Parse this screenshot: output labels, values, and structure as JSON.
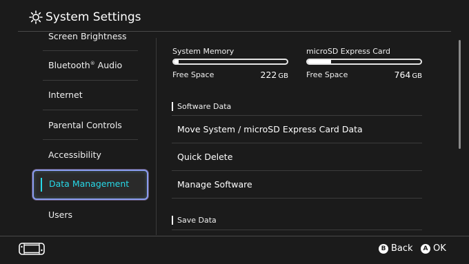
{
  "header": {
    "title": "System Settings",
    "icon": "gear-icon"
  },
  "sidebar": {
    "items": [
      {
        "label": "Screen Brightness"
      },
      {
        "label": "Bluetooth",
        "superscript": "®",
        "suffix": " Audio"
      },
      {
        "label": "Internet"
      },
      {
        "label": "Parental Controls"
      },
      {
        "label": "Accessibility"
      },
      {
        "label": "Data Management",
        "selected": true
      },
      {
        "label": "Users"
      }
    ]
  },
  "storage": {
    "system": {
      "label": "System Memory",
      "free_label": "Free Space",
      "free_value": "222",
      "free_unit": "GB",
      "used_fraction": 0.04
    },
    "sd": {
      "label": "microSD Express Card",
      "free_label": "Free Space",
      "free_value": "764",
      "free_unit": "GB",
      "used_fraction": 0.21
    }
  },
  "main": {
    "software_section": "Software Data",
    "rows": [
      {
        "label": "Move System / microSD Express Card Data"
      },
      {
        "label": "Quick Delete"
      },
      {
        "label": "Manage Software"
      }
    ],
    "save_section": "Save Data"
  },
  "footer": {
    "back": {
      "button": "B",
      "label": "Back"
    },
    "ok": {
      "button": "A",
      "label": "OK"
    },
    "console_icon": "console-icon"
  },
  "colors": {
    "background": "#1b1b1b",
    "accent": "#27d9e8",
    "selection_border": "#8a9cf0",
    "text": "#ffffff"
  }
}
